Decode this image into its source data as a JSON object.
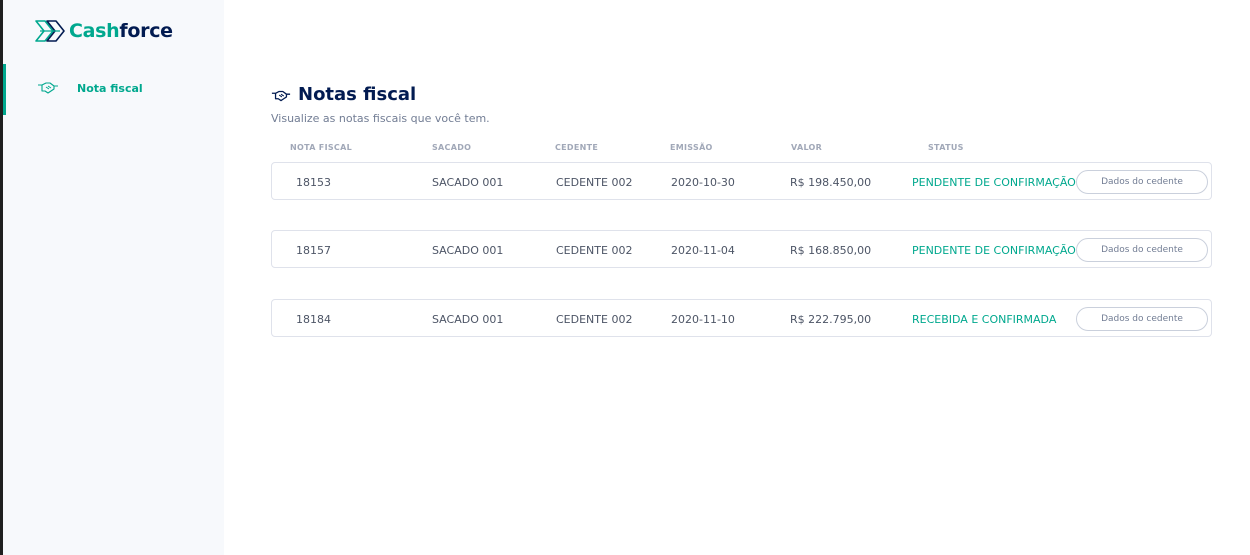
{
  "app": {
    "brand_part1": "Cash",
    "brand_part2": "force",
    "accent_color": "#00a88e",
    "dark_color": "#021b51"
  },
  "sidebar": {
    "items": [
      {
        "label": "Nota fiscal",
        "icon": "handshake-icon",
        "active": true
      }
    ]
  },
  "page": {
    "title": "Notas fiscal",
    "title_icon": "handshake-icon",
    "subtitle": "Visualize as notas fiscais que você tem."
  },
  "table": {
    "headers": [
      "NOTA FISCAL",
      "SACADO",
      "CEDENTE",
      "EMISSÃO",
      "VALOR",
      "STATUS"
    ],
    "rows": [
      {
        "nota": "18153",
        "sacado": "SACADO 001",
        "cedente": "CEDENTE 002",
        "emissao": "2020-10-30",
        "valor": "R$ 198.450,00",
        "status": "PENDENTE DE CONFIRMAÇÃO",
        "button": "Dados do cedente"
      },
      {
        "nota": "18157",
        "sacado": "SACADO 001",
        "cedente": "CEDENTE 002",
        "emissao": "2020-11-04",
        "valor": "R$ 168.850,00",
        "status": "PENDENTE DE CONFIRMAÇÃO",
        "button": "Dados do cedente"
      },
      {
        "nota": "18184",
        "sacado": "SACADO 001",
        "cedente": "CEDENTE 002",
        "emissao": "2020-11-10",
        "valor": "R$ 222.795,00",
        "status": "RECEBIDA E CONFIRMADA",
        "button": "Dados do cedente"
      }
    ]
  }
}
